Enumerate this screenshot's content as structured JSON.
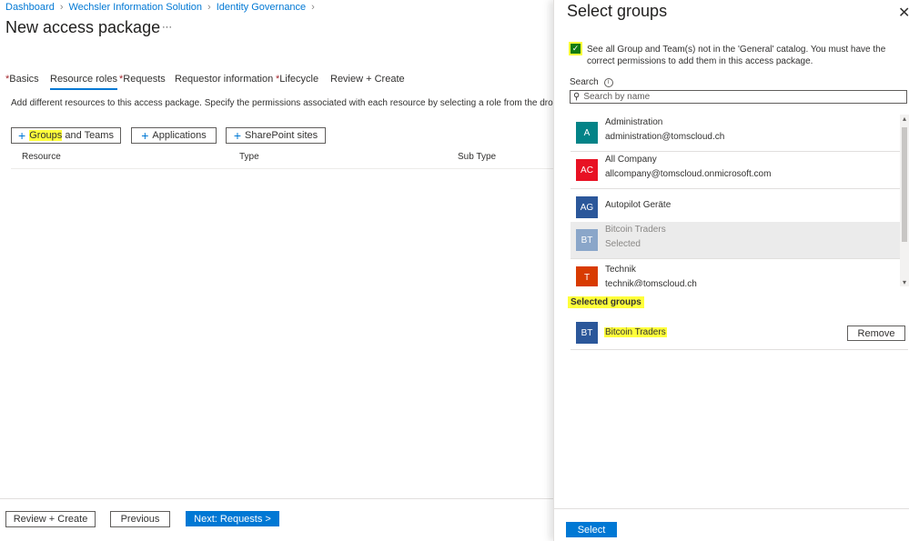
{
  "breadcrumb": [
    "Dashboard",
    "Wechsler Information Solution",
    "Identity Governance"
  ],
  "page_title": "New access package",
  "more_label": "···",
  "tabs": [
    {
      "label": "Basics",
      "required": true
    },
    {
      "label": "Resource roles",
      "required": false,
      "active": true
    },
    {
      "label": "Requests",
      "required": true
    },
    {
      "label": "Requestor information",
      "required": false
    },
    {
      "label": "Lifecycle",
      "required": true
    },
    {
      "label": "Review + Create",
      "required": false
    }
  ],
  "description": "Add different resources to this access package. Specify the permissions associated with each resource by selecting a role from the drop-down list.",
  "resource_buttons": {
    "groups_part1": "Groups",
    "groups_part2": " and Teams",
    "applications": "Applications",
    "sharepoint": "SharePoint sites"
  },
  "table_headers": [
    "Resource",
    "Type",
    "Sub Type"
  ],
  "footer": {
    "review": "Review + Create",
    "previous": "Previous",
    "next": "Next: Requests >"
  },
  "panel": {
    "title": "Select groups",
    "close_icon": "close-icon",
    "checkbox_checked": true,
    "checkbox_text": "See all Group and Team(s) not in the 'General' catalog. You must have the correct permissions to add them in this access package.",
    "search_label": "Search",
    "search_placeholder": "Search by name",
    "groups": [
      {
        "initials": "A",
        "name": "Administration",
        "email": "administration@tomscloud.ch",
        "color": "#038387",
        "selected": false
      },
      {
        "initials": "AC",
        "name": "All Company",
        "email": "allcompany@tomscloud.onmicrosoft.com",
        "color": "#e81123",
        "selected": false
      },
      {
        "initials": "AG",
        "name": "Autopilot Geräte",
        "email": "",
        "color": "#2b579a",
        "selected": false
      },
      {
        "initials": "BT",
        "name": "Bitcoin Traders",
        "email": "Selected",
        "color": "#8aa6c9",
        "selected": true
      },
      {
        "initials": "T",
        "name": "Technik",
        "email": "technik@tomscloud.ch",
        "color": "#d83b01",
        "selected": false
      }
    ],
    "selected_heading": "Selected groups",
    "selected_items": [
      {
        "initials": "BT",
        "name": "Bitcoin Traders",
        "color": "#2b579a",
        "remove_label": "Remove"
      }
    ],
    "select_button": "Select"
  },
  "colors": {
    "accent": "#0078d4",
    "highlight": "#ffff3a",
    "checkbox": "#107c10"
  }
}
